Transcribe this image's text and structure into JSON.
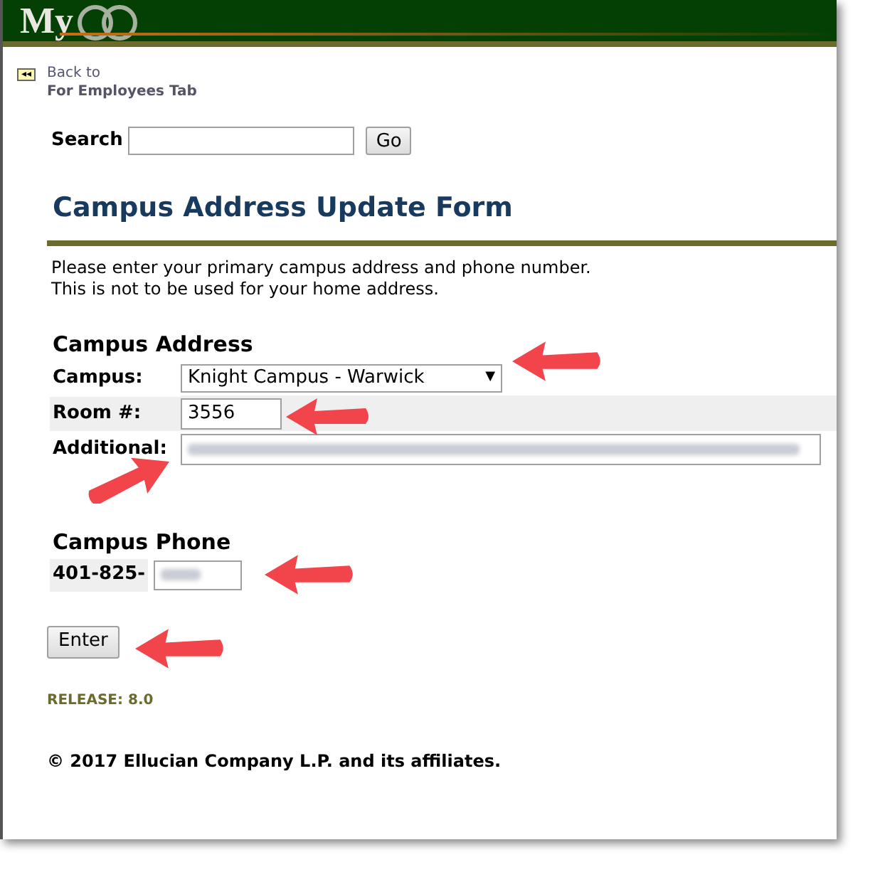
{
  "header": {
    "logo": "My"
  },
  "back_link": {
    "icon": "◂◂",
    "line_1": "Back to",
    "line_2": "For Employees Tab"
  },
  "search": {
    "label": "Search",
    "button": "Go"
  },
  "title": "Campus Address Update Form",
  "instructions": [
    "Please enter your primary campus address and phone number.",
    "This is not to be used for your home address."
  ],
  "address": {
    "heading": "Campus Address",
    "fields": [
      {
        "label": "Campus:",
        "kind": "select",
        "value": "Knight Campus - Warwick",
        "caret": "▼",
        "shaded": false
      },
      {
        "label": "Room #:",
        "kind": "text",
        "value": "3556",
        "shaded": true
      },
      {
        "label": "Additional:",
        "kind": "blurred",
        "shaded": false
      }
    ]
  },
  "phone": {
    "heading": "Campus Phone",
    "prefix": "401-825-",
    "extension_blurred": true
  },
  "submit": "Enter",
  "release": "RELEASE: 8.0",
  "copyright": "© 2017 Ellucian Company L.P. and its affiliates."
}
